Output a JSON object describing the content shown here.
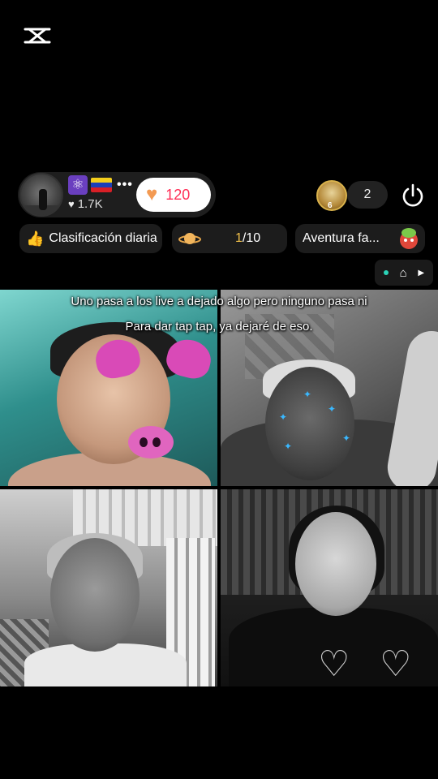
{
  "watermark": {
    "icon": "capcut-logo-icon"
  },
  "host": {
    "likes": "1.7K",
    "gift_count": "120"
  },
  "viewers": {
    "top_viewer_level": "6",
    "count": "2"
  },
  "pills": {
    "ranking_label": "Clasificación diaria",
    "progress_current": "1",
    "progress_total": "/10",
    "adventure_label": "Aventura fa..."
  },
  "caption": {
    "line1": "Uno pasa a los live a dejado algo pero ninguno pasa ni",
    "line2": "Para dar tap tap, ya dejaré de eso."
  },
  "colors": {
    "accent_heart": "#f39a52",
    "gift_number": "#ff2d55",
    "progress_highlight": "#f1c04a",
    "status_dot": "#2bd3b7"
  }
}
